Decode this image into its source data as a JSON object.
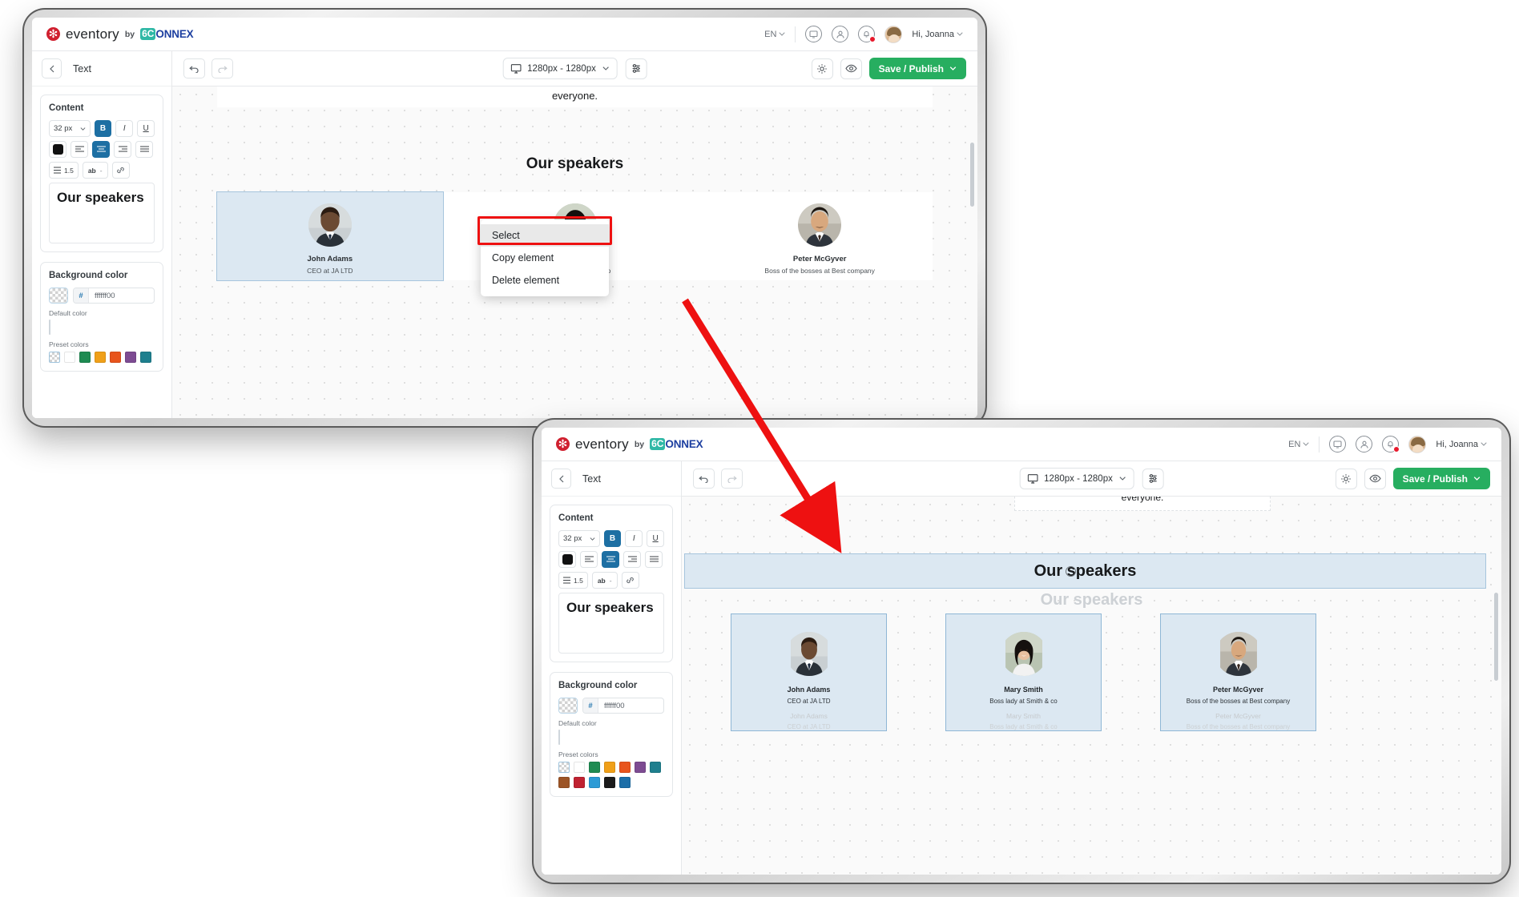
{
  "header": {
    "brand_name": "eventory",
    "brand_by": "by",
    "partner_prefix": "6C",
    "partner_rest": "ONNEX",
    "lang": "EN",
    "user_greeting": "Hi, Joanna",
    "icons": [
      "screen-icon",
      "user-circle-icon",
      "notification-bell-icon"
    ]
  },
  "toolbar": {
    "back_label": "‹",
    "panel_title": "Text",
    "undo_label": "undo-icon",
    "redo_label": "redo-icon",
    "device_size": "1280px - 1280px",
    "settings_label": "settings-sliders-icon",
    "gear_label": "gear-icon",
    "preview_label": "eye-icon",
    "save_label": "Save / Publish"
  },
  "sidebar": {
    "content_label": "Content",
    "font_size": "32 px",
    "bold_label": "B",
    "italic_label": "I",
    "underline_label": "U",
    "line_height": "1.5",
    "letter_spacing": "ab",
    "letter_spacing_value": "-",
    "text_preview": "Our speakers",
    "background_label": "Background color",
    "bg_hash": "#",
    "bg_hex": "ffffff00",
    "default_color_label": "Default color",
    "preset_label": "Preset colors",
    "preset_colors": [
      "transparent",
      "#ffffff",
      "#1e8b52",
      "#f0a019",
      "#e8541c",
      "#7d4b92",
      "#1e7f8e",
      "#9c5426",
      "#c02231",
      "#2c9bd6",
      "#1b1b1b",
      "#1b6ea8"
    ]
  },
  "canvas": {
    "top_text": "everyone.",
    "section_title": "Our speakers",
    "speakers": [
      {
        "name": "John Adams",
        "role": "CEO at JA LTD",
        "photo": "photo-john"
      },
      {
        "name": "Mary Smith",
        "role": "Boss lady at Smith & co",
        "photo": "photo-mary"
      },
      {
        "name": "Peter McGyver",
        "role": "Boss of the bosses at Best company",
        "photo": "photo-peter"
      }
    ]
  },
  "context_menu": {
    "items": [
      "Select",
      "Copy element",
      "Delete element"
    ],
    "highlighted": "Select"
  },
  "front_window": {
    "top_text": "everyone.",
    "dragged_title": "Our speakers",
    "ghost_title": "Our speakers",
    "speakers": [
      {
        "name": "John Adams",
        "role": "CEO at JA LTD"
      },
      {
        "name": "Mary Smith",
        "role": "Boss lady at Smith & co"
      },
      {
        "name": "Peter McGyver",
        "role": "Boss of the bosses at Best company"
      }
    ]
  },
  "colors": {
    "accent_green": "#27ae60",
    "accent_blue": "#1d6fa3",
    "selection_blue": "#dce8f2",
    "annotation_red": "#ee1111",
    "brand_red": "#d0202f"
  }
}
